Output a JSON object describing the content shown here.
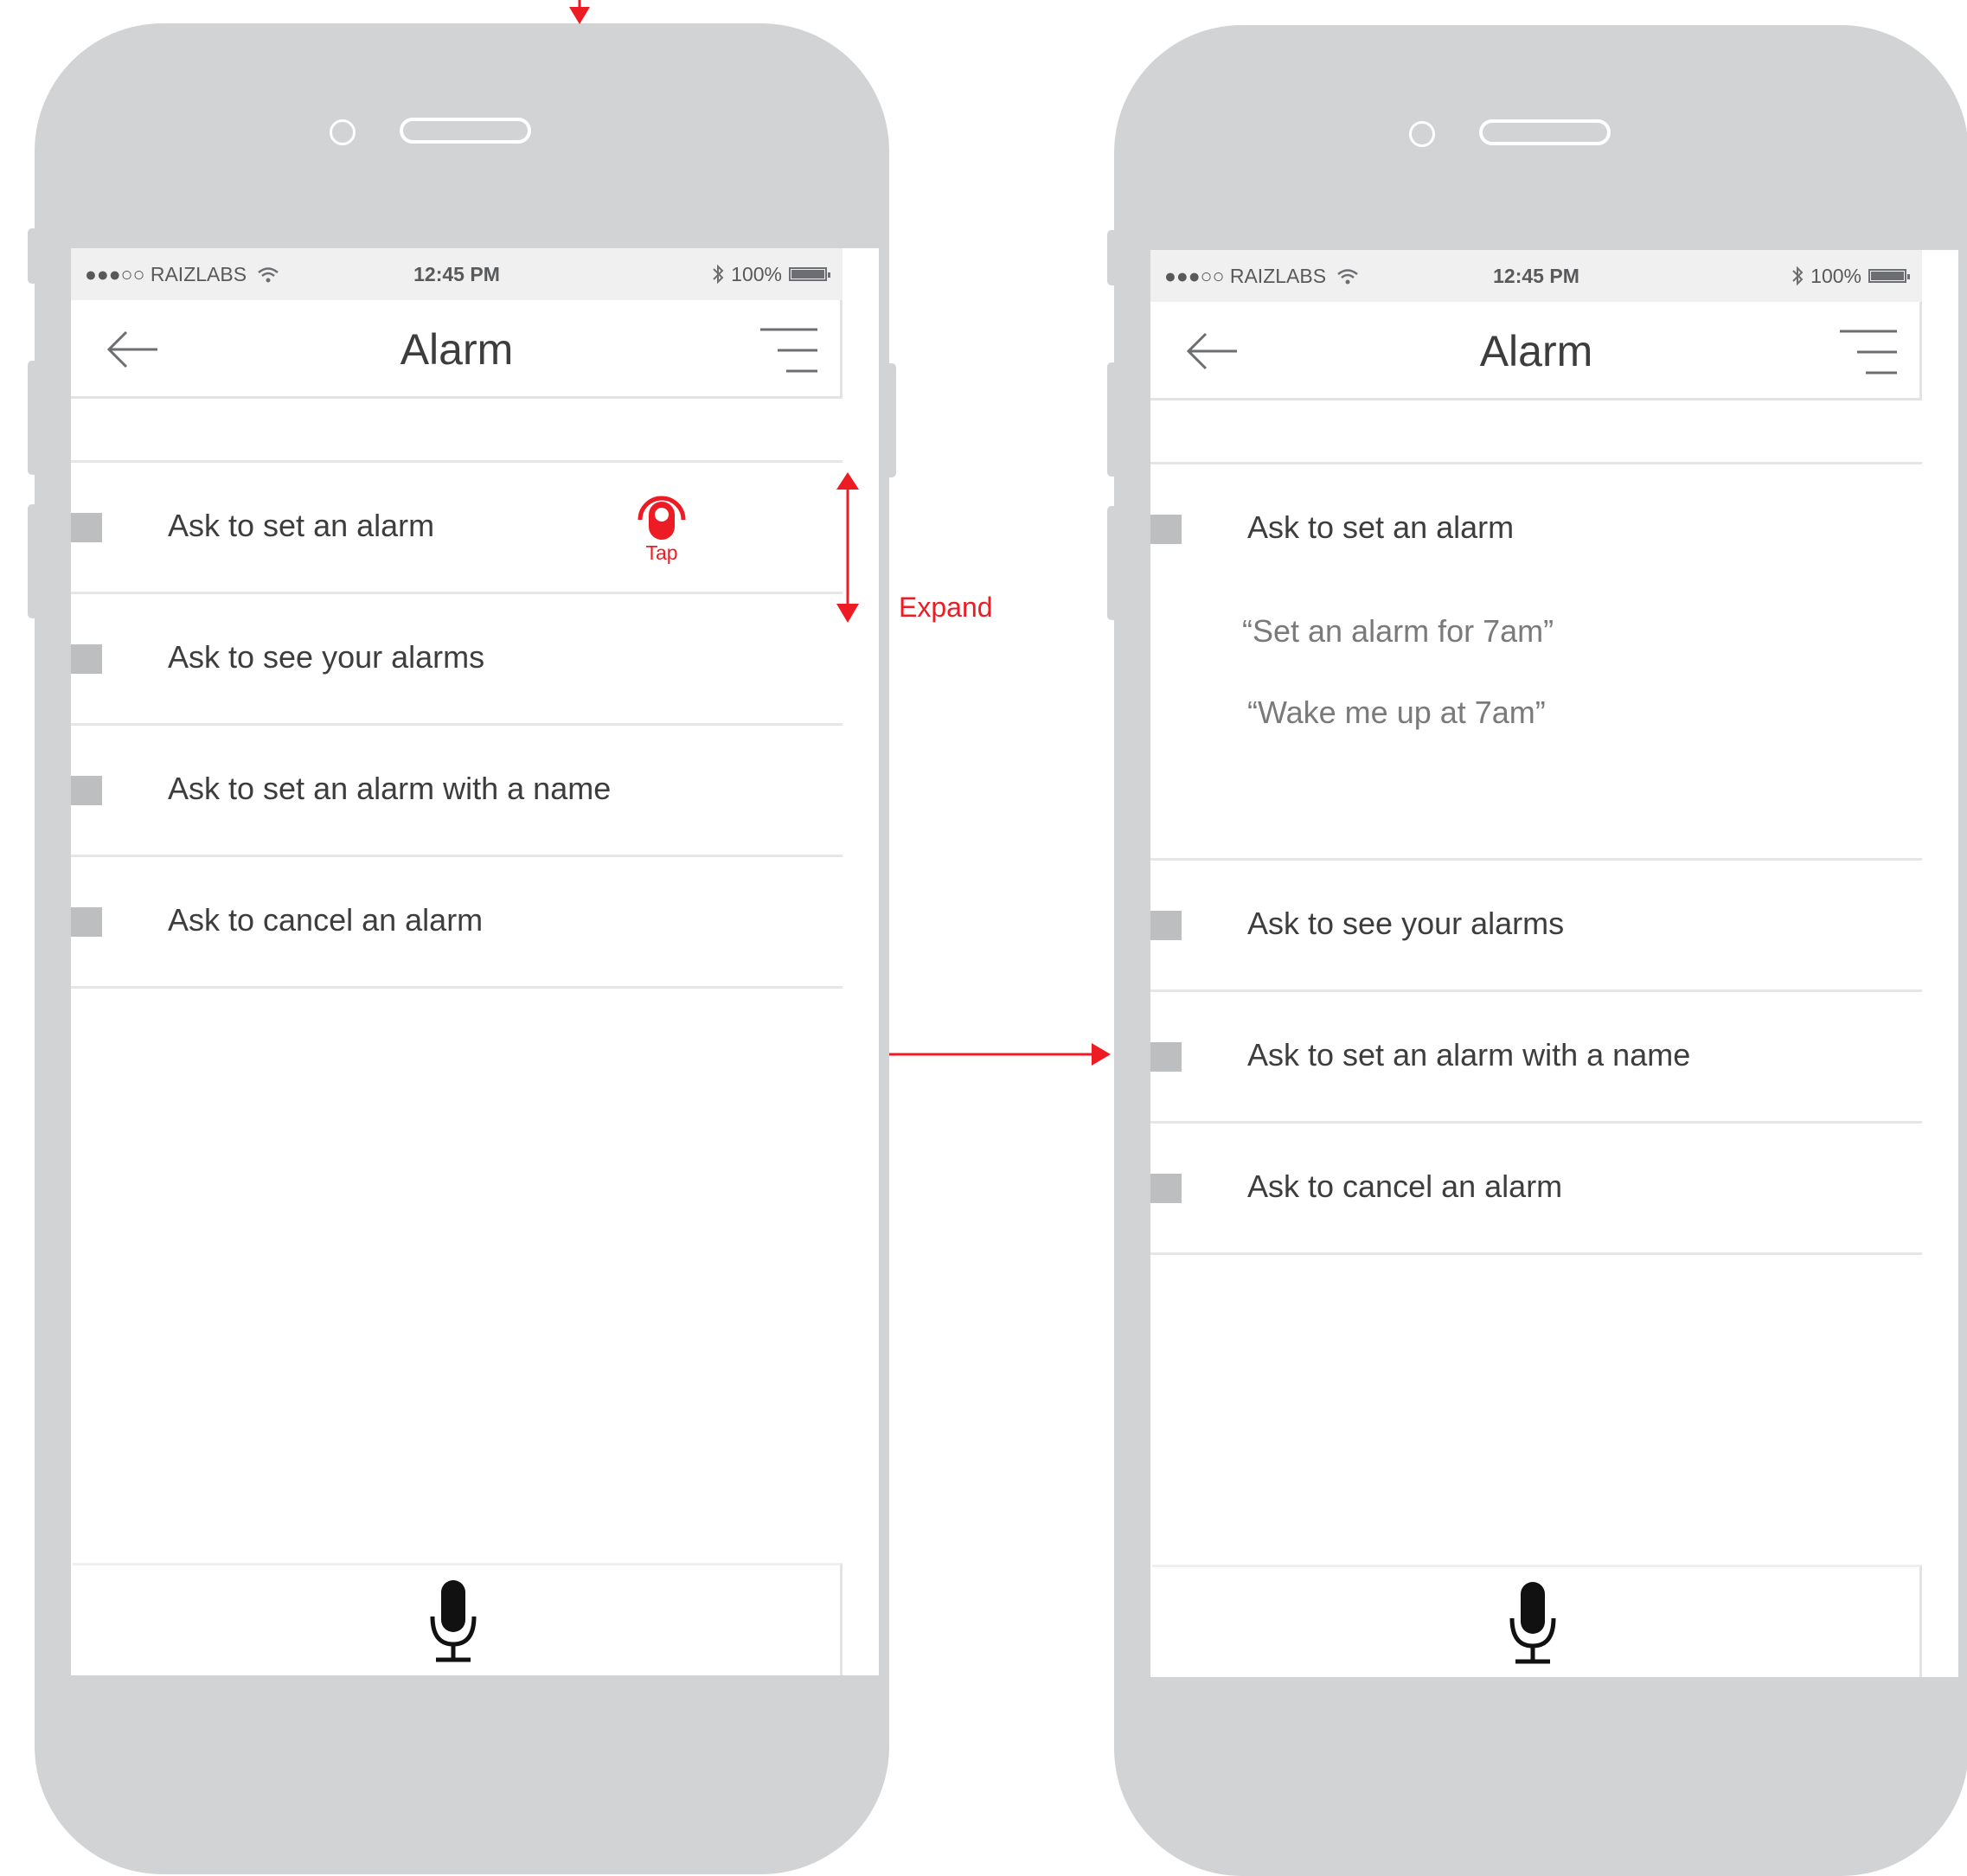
{
  "status_bar": {
    "carrier": "●●●○○ RAIZLABS",
    "time": "12:45 PM",
    "battery": "100%"
  },
  "nav": {
    "title": "Alarm"
  },
  "left_screen": {
    "items": [
      {
        "label": "Ask to set an alarm"
      },
      {
        "label": "Ask to see your alarms"
      },
      {
        "label": "Ask to set an alarm with a name"
      },
      {
        "label": "Ask to cancel an alarm"
      }
    ]
  },
  "right_screen": {
    "items": [
      {
        "label": "Ask to set an alarm",
        "examples": [
          "“Set an alarm for 7am”",
          "“Wake me up at 7am”"
        ]
      },
      {
        "label": "Ask to see your alarms"
      },
      {
        "label": "Ask to set an alarm with a name"
      },
      {
        "label": "Ask to cancel an alarm"
      }
    ]
  },
  "annotations": {
    "tap_label": "Tap",
    "expand_label": "Expand",
    "accent_color": "#ed1c24"
  },
  "icons": [
    "back-arrow-icon",
    "menu-icon",
    "wifi-icon",
    "bluetooth-icon",
    "battery-icon",
    "microphone-icon",
    "tap-gesture-icon"
  ]
}
